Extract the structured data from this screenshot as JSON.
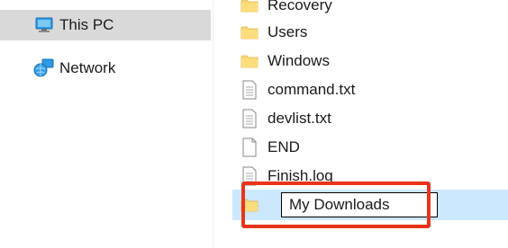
{
  "navigation": {
    "items": [
      {
        "label": "This PC",
        "icon": "computer-icon",
        "selected": true
      },
      {
        "label": "Network",
        "icon": "network-icon",
        "selected": false
      }
    ]
  },
  "files": {
    "items": [
      {
        "name": "Recovery",
        "type": "folder"
      },
      {
        "name": "Users",
        "type": "folder"
      },
      {
        "name": "Windows",
        "type": "folder"
      },
      {
        "name": "command.txt",
        "type": "text-file"
      },
      {
        "name": "devlist.txt",
        "type": "text-file"
      },
      {
        "name": "END",
        "type": "file"
      },
      {
        "name": "Finish.log",
        "type": "text-file"
      }
    ],
    "renaming": {
      "name": "My Downloads",
      "type": "folder"
    }
  },
  "colors": {
    "selection_nav": "#d9d9d9",
    "selection_file": "#cce8ff",
    "annotation_box": "#e8341a",
    "folder_yellow": "#f8d775"
  }
}
